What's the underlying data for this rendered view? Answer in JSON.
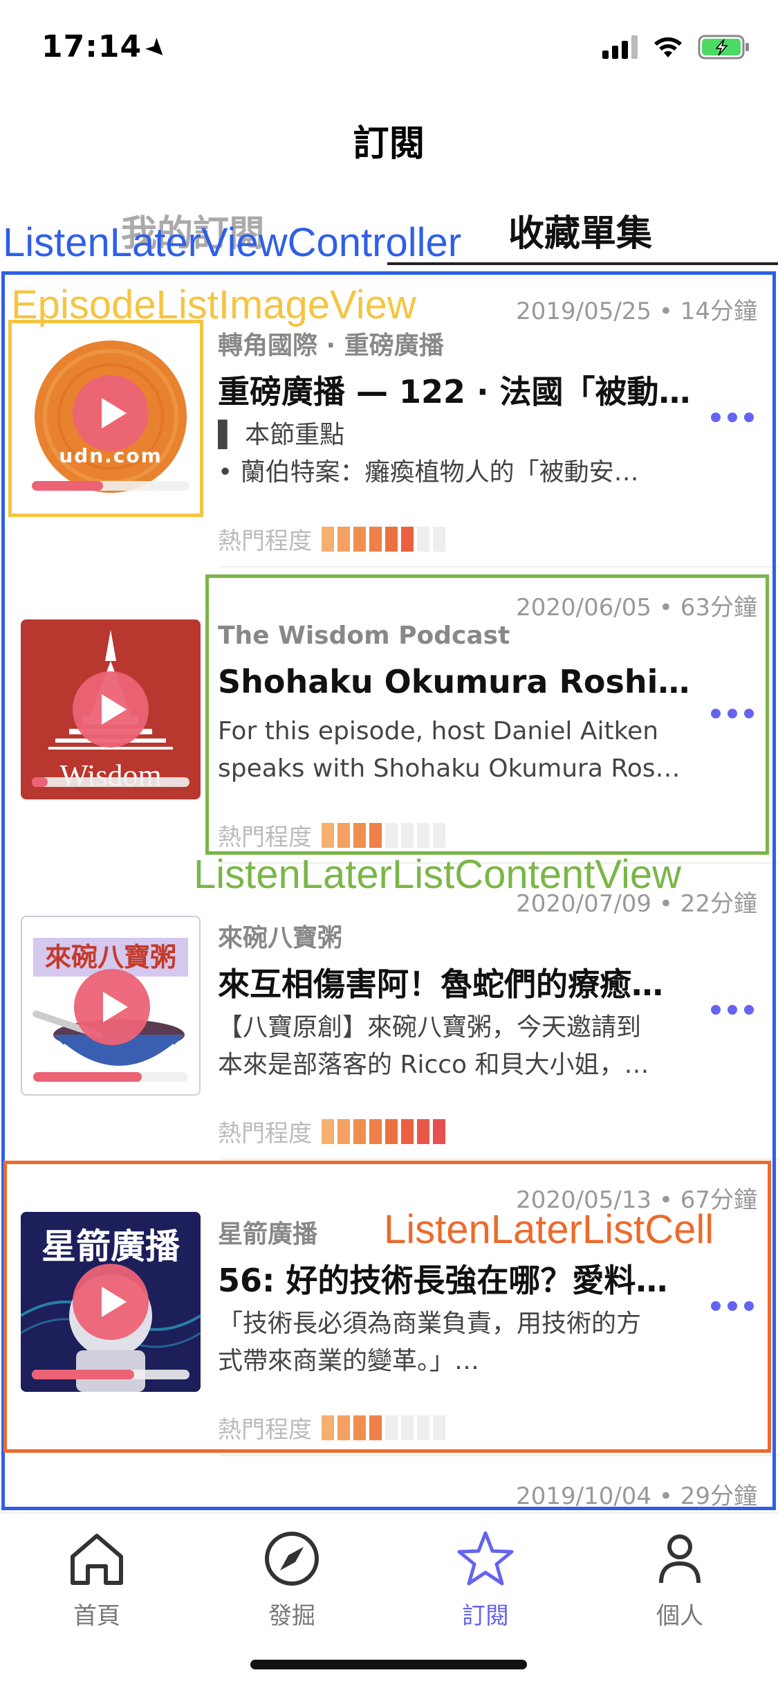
{
  "status": {
    "time": "17:14"
  },
  "nav": {
    "title": "訂閱"
  },
  "tabs": {
    "mine": "我的訂閱",
    "saved": "收藏單集"
  },
  "annotations": {
    "controller": "ListenLaterViewController",
    "image_view": "EpisodeListImageView",
    "content_view": "ListenLaterListContentView",
    "cell": "ListenLaterListCell",
    "colors": {
      "blue": "#2f5fe8",
      "yellow": "#f4c542",
      "green": "#7ab648",
      "orange": "#ec6a2c"
    }
  },
  "popularity_label": "熱門程度",
  "episodes": [
    {
      "meta": "2019/05/25 • 14分鐘",
      "podcast": "轉角國際 · 重磅廣播",
      "title": "重磅廣播 — 122 · 法國「被動…",
      "desc": [
        "▌ 本節重點",
        "• 蘭伯特案：癱瘓植物人的「被動安…"
      ],
      "artwork_text": "udn.com",
      "artwork_icon": "udn-logo",
      "progress": 0.45,
      "popularity": 6
    },
    {
      "meta": "2020/06/05 • 63分鐘",
      "podcast": "The Wisdom Podcast",
      "title": "Shohaku Okumura Roshi: S…",
      "desc": [
        "For this episode, host Daniel Aitken",
        "speaks with Shohaku Okumura Ros…"
      ],
      "artwork_text": "Wisdom",
      "artwork_icon": "stupa-logo",
      "progress": 0.1,
      "popularity": 4
    },
    {
      "meta": "2020/07/09 • 22分鐘",
      "podcast": "來碗八寶粥",
      "title": "來互相傷害阿！魯蛇們的療癒…",
      "desc": [
        "【八寶原創】來碗八寶粥，今天邀請到",
        "本來是部落客的 Ricco 和貝大小姐，…"
      ],
      "artwork_text": "來碗八寶粥",
      "artwork_icon": "porridge-bowl",
      "progress": 0.7,
      "popularity": 8
    },
    {
      "meta": "2020/05/13 • 67分鐘",
      "podcast": "星箭廣播",
      "title": "56: 好的技術長強在哪？愛料…",
      "desc": [
        "「技術長必須為商業負責，用技術的方",
        "式帶來商業的變革。」…"
      ],
      "artwork_text": "星箭廣播",
      "artwork_icon": "astronaut",
      "progress": 0.65,
      "popularity": 4
    },
    {
      "meta": "2019/10/04 • 29分鐘"
    }
  ],
  "tabbar": [
    {
      "label": "首頁",
      "icon": "home-icon"
    },
    {
      "label": "發掘",
      "icon": "compass-icon"
    },
    {
      "label": "訂閱",
      "icon": "star-icon",
      "active": true
    },
    {
      "label": "個人",
      "icon": "person-icon"
    }
  ],
  "theme": {
    "accent": "#6464f0",
    "play": "#ec6376"
  }
}
